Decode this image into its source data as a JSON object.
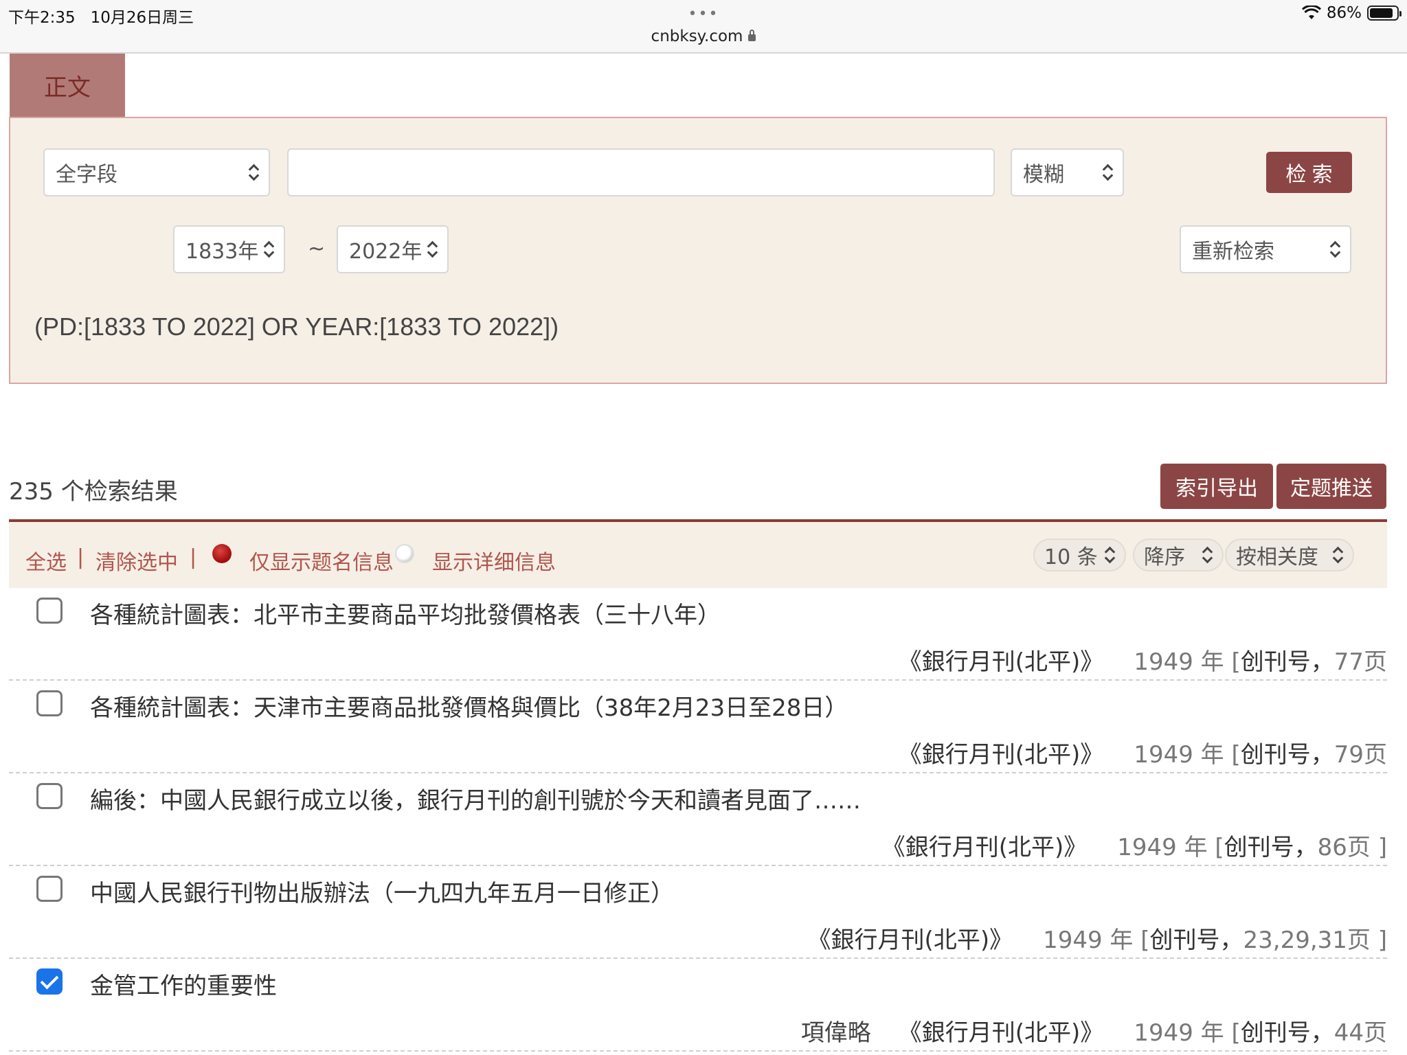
{
  "status_bar": {
    "time": "下午2:35",
    "date": "10月26日周三",
    "dots": "•••",
    "url": "cnbksy.com",
    "battery": "86%",
    "battery_level": 0.86
  },
  "tab": {
    "label": "正文"
  },
  "search": {
    "field_select": "全字段",
    "keyword_value": "",
    "match_select": "模糊",
    "search_button": "检 索",
    "year_from": "1833年",
    "year_to": "2022年",
    "tilde": "~",
    "mode_select": "重新检索",
    "query_expression": "(PD:[1833 TO 2022] OR YEAR:[1833 TO 2022])"
  },
  "results_header": {
    "count": "235 个检索结果",
    "export_button": "索引导出",
    "subscribe_button": "定题推送"
  },
  "toolbar": {
    "select_all": "全选",
    "clear_selection": "清除选中",
    "separator": "|",
    "show_title_only": "仅显示题名信息",
    "show_details": "显示详细信息",
    "page_size": "10 条",
    "order": "降序",
    "sort_by": "按相关度"
  },
  "results": [
    {
      "title": "各種統計圖表：北平市主要商品平均批發價格表（三十八年）",
      "author": "",
      "journal": "《銀行月刊(北平)》",
      "year": "1949 年 [",
      "issue": " 创刊号，",
      "page": " 77页",
      "checked": false
    },
    {
      "title": "各種統計圖表：天津市主要商品批發價格與價比（38年2月23日至28日）",
      "author": "",
      "journal": "《銀行月刊(北平)》",
      "year": "1949 年 [",
      "issue": " 创刊号，",
      "page": " 79页",
      "checked": false
    },
    {
      "title": "編後：中國人民銀行成立以後，銀行月刊的創刊號於今天和讀者見面了……",
      "author": "",
      "journal": "《銀行月刊(北平)》",
      "year": "1949 年 [",
      "issue": " 创刊号，",
      "page": " 86页 ]",
      "checked": false
    },
    {
      "title": "中國人民銀行刊物出版辦法（一九四九年五月一日修正）",
      "author": "",
      "journal": "《銀行月刊(北平)》",
      "year": "1949 年 [",
      "issue": " 创刊号，",
      "page": " 23,29,31页 ]",
      "checked": false
    },
    {
      "title": "金管工作的重要性",
      "author": "項偉略",
      "journal": "《銀行月刊(北平)》",
      "year": "1949 年 [",
      "issue": " 创刊号，",
      "page": " 44页",
      "checked": true
    }
  ],
  "colors": {
    "accent": "#8c4545",
    "tab": "#b27a76",
    "panel_bg": "#f6efe6",
    "link": "#b0564c",
    "checkbox_checked": "#1a73e8"
  }
}
